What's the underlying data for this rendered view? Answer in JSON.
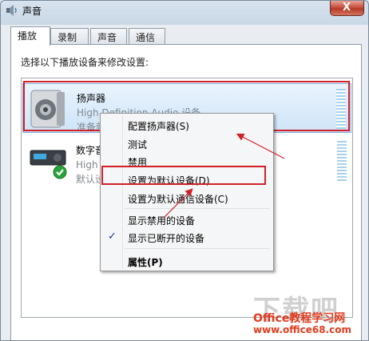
{
  "window": {
    "title": "声音",
    "close_label": "X"
  },
  "tabs": [
    {
      "label": "播放",
      "active": true
    },
    {
      "label": "录制",
      "active": false
    },
    {
      "label": "声音",
      "active": false
    },
    {
      "label": "通信",
      "active": false
    }
  ],
  "instruction": "选择以下播放设备来修改设置:",
  "devices": [
    {
      "name": "扬声器",
      "description": "High Definition Audio 设备",
      "status": "准备就绪"
    },
    {
      "name": "数字音频",
      "description": "High Definition Audio 设备",
      "status": "默认设备"
    }
  ],
  "context_menu": [
    {
      "label": "配置扬声器(S)"
    },
    {
      "label": "测试"
    },
    {
      "label": "禁用"
    },
    {
      "label": "设置为默认设备(D)"
    },
    {
      "label": "设置为默认通信设备(C)"
    },
    {
      "label": "显示禁用的设备"
    },
    {
      "label": "显示已断开的设备",
      "checked": true
    },
    {
      "label": "属性(P)"
    }
  ],
  "watermark": {
    "big": "下载吧",
    "line1": "Office教程学习网",
    "line2": "www.office68.com"
  },
  "colors": {
    "highlight": "#d0202a",
    "selection": "#cde4f8",
    "watermark": "#e23a1c"
  }
}
